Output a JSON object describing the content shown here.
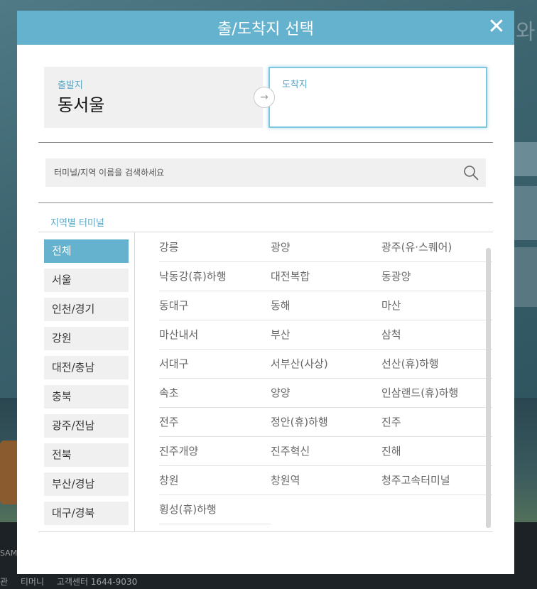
{
  "background": {
    "side_text": "와",
    "logo_text": "SAM",
    "footer_links": [
      "관",
      "티머니",
      "고객센터 1644-9030"
    ]
  },
  "modal": {
    "title": "출/도착지 선택",
    "close_symbol": "✕"
  },
  "route": {
    "departure_label": "출발지",
    "departure_value": "동서울",
    "arrow_symbol": "→",
    "arrival_label": "도착지",
    "arrival_value": ""
  },
  "search": {
    "placeholder": "터미널/지역 이름을 검색하세요",
    "value": "",
    "icon": "search-icon"
  },
  "section_title": "지역별 터미널",
  "regions": [
    "전체",
    "서울",
    "인천/경기",
    "강원",
    "대전/충남",
    "충북",
    "광주/전남",
    "전북",
    "부산/경남",
    "대구/경북"
  ],
  "selected_region": "전체",
  "terminals": [
    [
      "강릉",
      "광양",
      "광주(유·스퀘어)"
    ],
    [
      "낙동강(휴)하행",
      "대전복합",
      "동광양"
    ],
    [
      "동대구",
      "동해",
      "마산"
    ],
    [
      "마산내서",
      "부산",
      "삼척"
    ],
    [
      "서대구",
      "서부산(사상)",
      "선산(휴)하행"
    ],
    [
      "속초",
      "양양",
      "인삼랜드(휴)하행"
    ],
    [
      "전주",
      "정안(휴)하행",
      "진주"
    ],
    [
      "진주개양",
      "진주혁신",
      "진해"
    ],
    [
      "창원",
      "창원역",
      "청주고속터미널"
    ],
    [
      "횡성(휴)하행"
    ]
  ],
  "colors": {
    "accent": "#64b2cd",
    "label": "#5aa6c4",
    "inactive_bg": "#f0f0f0"
  }
}
